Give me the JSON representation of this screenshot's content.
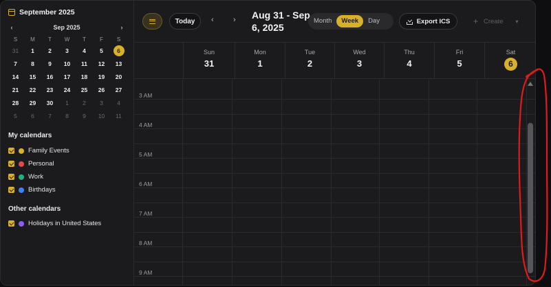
{
  "mini_calendar": {
    "title": "September 2025",
    "month_label": "Sep 2025",
    "prev_icon": "chevron-left-icon",
    "next_icon": "chevron-right-icon",
    "weekday_headers": [
      "S",
      "M",
      "T",
      "W",
      "T",
      "F",
      "S"
    ],
    "weeks": [
      [
        {
          "d": "31",
          "dim": true
        },
        {
          "d": "1"
        },
        {
          "d": "2"
        },
        {
          "d": "3"
        },
        {
          "d": "4"
        },
        {
          "d": "5"
        },
        {
          "d": "6",
          "today": true
        }
      ],
      [
        {
          "d": "7"
        },
        {
          "d": "8"
        },
        {
          "d": "9"
        },
        {
          "d": "10"
        },
        {
          "d": "11"
        },
        {
          "d": "12"
        },
        {
          "d": "13"
        }
      ],
      [
        {
          "d": "14"
        },
        {
          "d": "15"
        },
        {
          "d": "16"
        },
        {
          "d": "17"
        },
        {
          "d": "18"
        },
        {
          "d": "19"
        },
        {
          "d": "20"
        }
      ],
      [
        {
          "d": "21"
        },
        {
          "d": "22"
        },
        {
          "d": "23"
        },
        {
          "d": "24"
        },
        {
          "d": "25"
        },
        {
          "d": "26"
        },
        {
          "d": "27"
        }
      ],
      [
        {
          "d": "28"
        },
        {
          "d": "29"
        },
        {
          "d": "30"
        },
        {
          "d": "1",
          "dim": true
        },
        {
          "d": "2",
          "dim": true
        },
        {
          "d": "3",
          "dim": true
        },
        {
          "d": "4",
          "dim": true
        }
      ],
      [
        {
          "d": "5",
          "dim": true
        },
        {
          "d": "6",
          "dim": true
        },
        {
          "d": "7",
          "dim": true
        },
        {
          "d": "8",
          "dim": true
        },
        {
          "d": "9",
          "dim": true
        },
        {
          "d": "10",
          "dim": true
        },
        {
          "d": "11",
          "dim": true
        }
      ]
    ]
  },
  "my_calendars": {
    "title": "My calendars",
    "items": [
      {
        "label": "Family Events",
        "color": "#d8b02a",
        "checked": true
      },
      {
        "label": "Personal",
        "color": "#e5484d",
        "checked": true
      },
      {
        "label": "Work",
        "color": "#22b07d",
        "checked": true
      },
      {
        "label": "Birthdays",
        "color": "#3b82f6",
        "checked": true
      }
    ]
  },
  "other_calendars": {
    "title": "Other calendars",
    "items": [
      {
        "label": "Holidays in United States",
        "color": "#8b5cf6",
        "checked": true
      }
    ]
  },
  "header": {
    "menu_icon": "hamburger-menu-icon",
    "today_label": "Today",
    "prev_icon": "chevron-left-icon",
    "next_icon": "chevron-right-icon",
    "range_title": "Aug 31 - Sep 6, 2025",
    "views": [
      {
        "label": "Month",
        "active": false
      },
      {
        "label": "Week",
        "active": true
      },
      {
        "label": "Day",
        "active": false
      }
    ],
    "export_label": "Export ICS",
    "export_icon": "download-icon",
    "create_label": "Create",
    "create_icon": "plus-icon"
  },
  "week": {
    "days": [
      {
        "name": "Sun",
        "date": "31",
        "today": false
      },
      {
        "name": "Mon",
        "date": "1",
        "today": false
      },
      {
        "name": "Tue",
        "date": "2",
        "today": false
      },
      {
        "name": "Wed",
        "date": "3",
        "today": false
      },
      {
        "name": "Thu",
        "date": "4",
        "today": false
      },
      {
        "name": "Fri",
        "date": "5",
        "today": false
      },
      {
        "name": "Sat",
        "date": "6",
        "today": true
      }
    ],
    "time_labels": [
      "3 AM",
      "4 AM",
      "5 AM",
      "6 AM",
      "7 AM",
      "8 AM",
      "9 AM"
    ]
  },
  "colors": {
    "accent": "#d8b02a",
    "annotation": "#e01b1b"
  }
}
